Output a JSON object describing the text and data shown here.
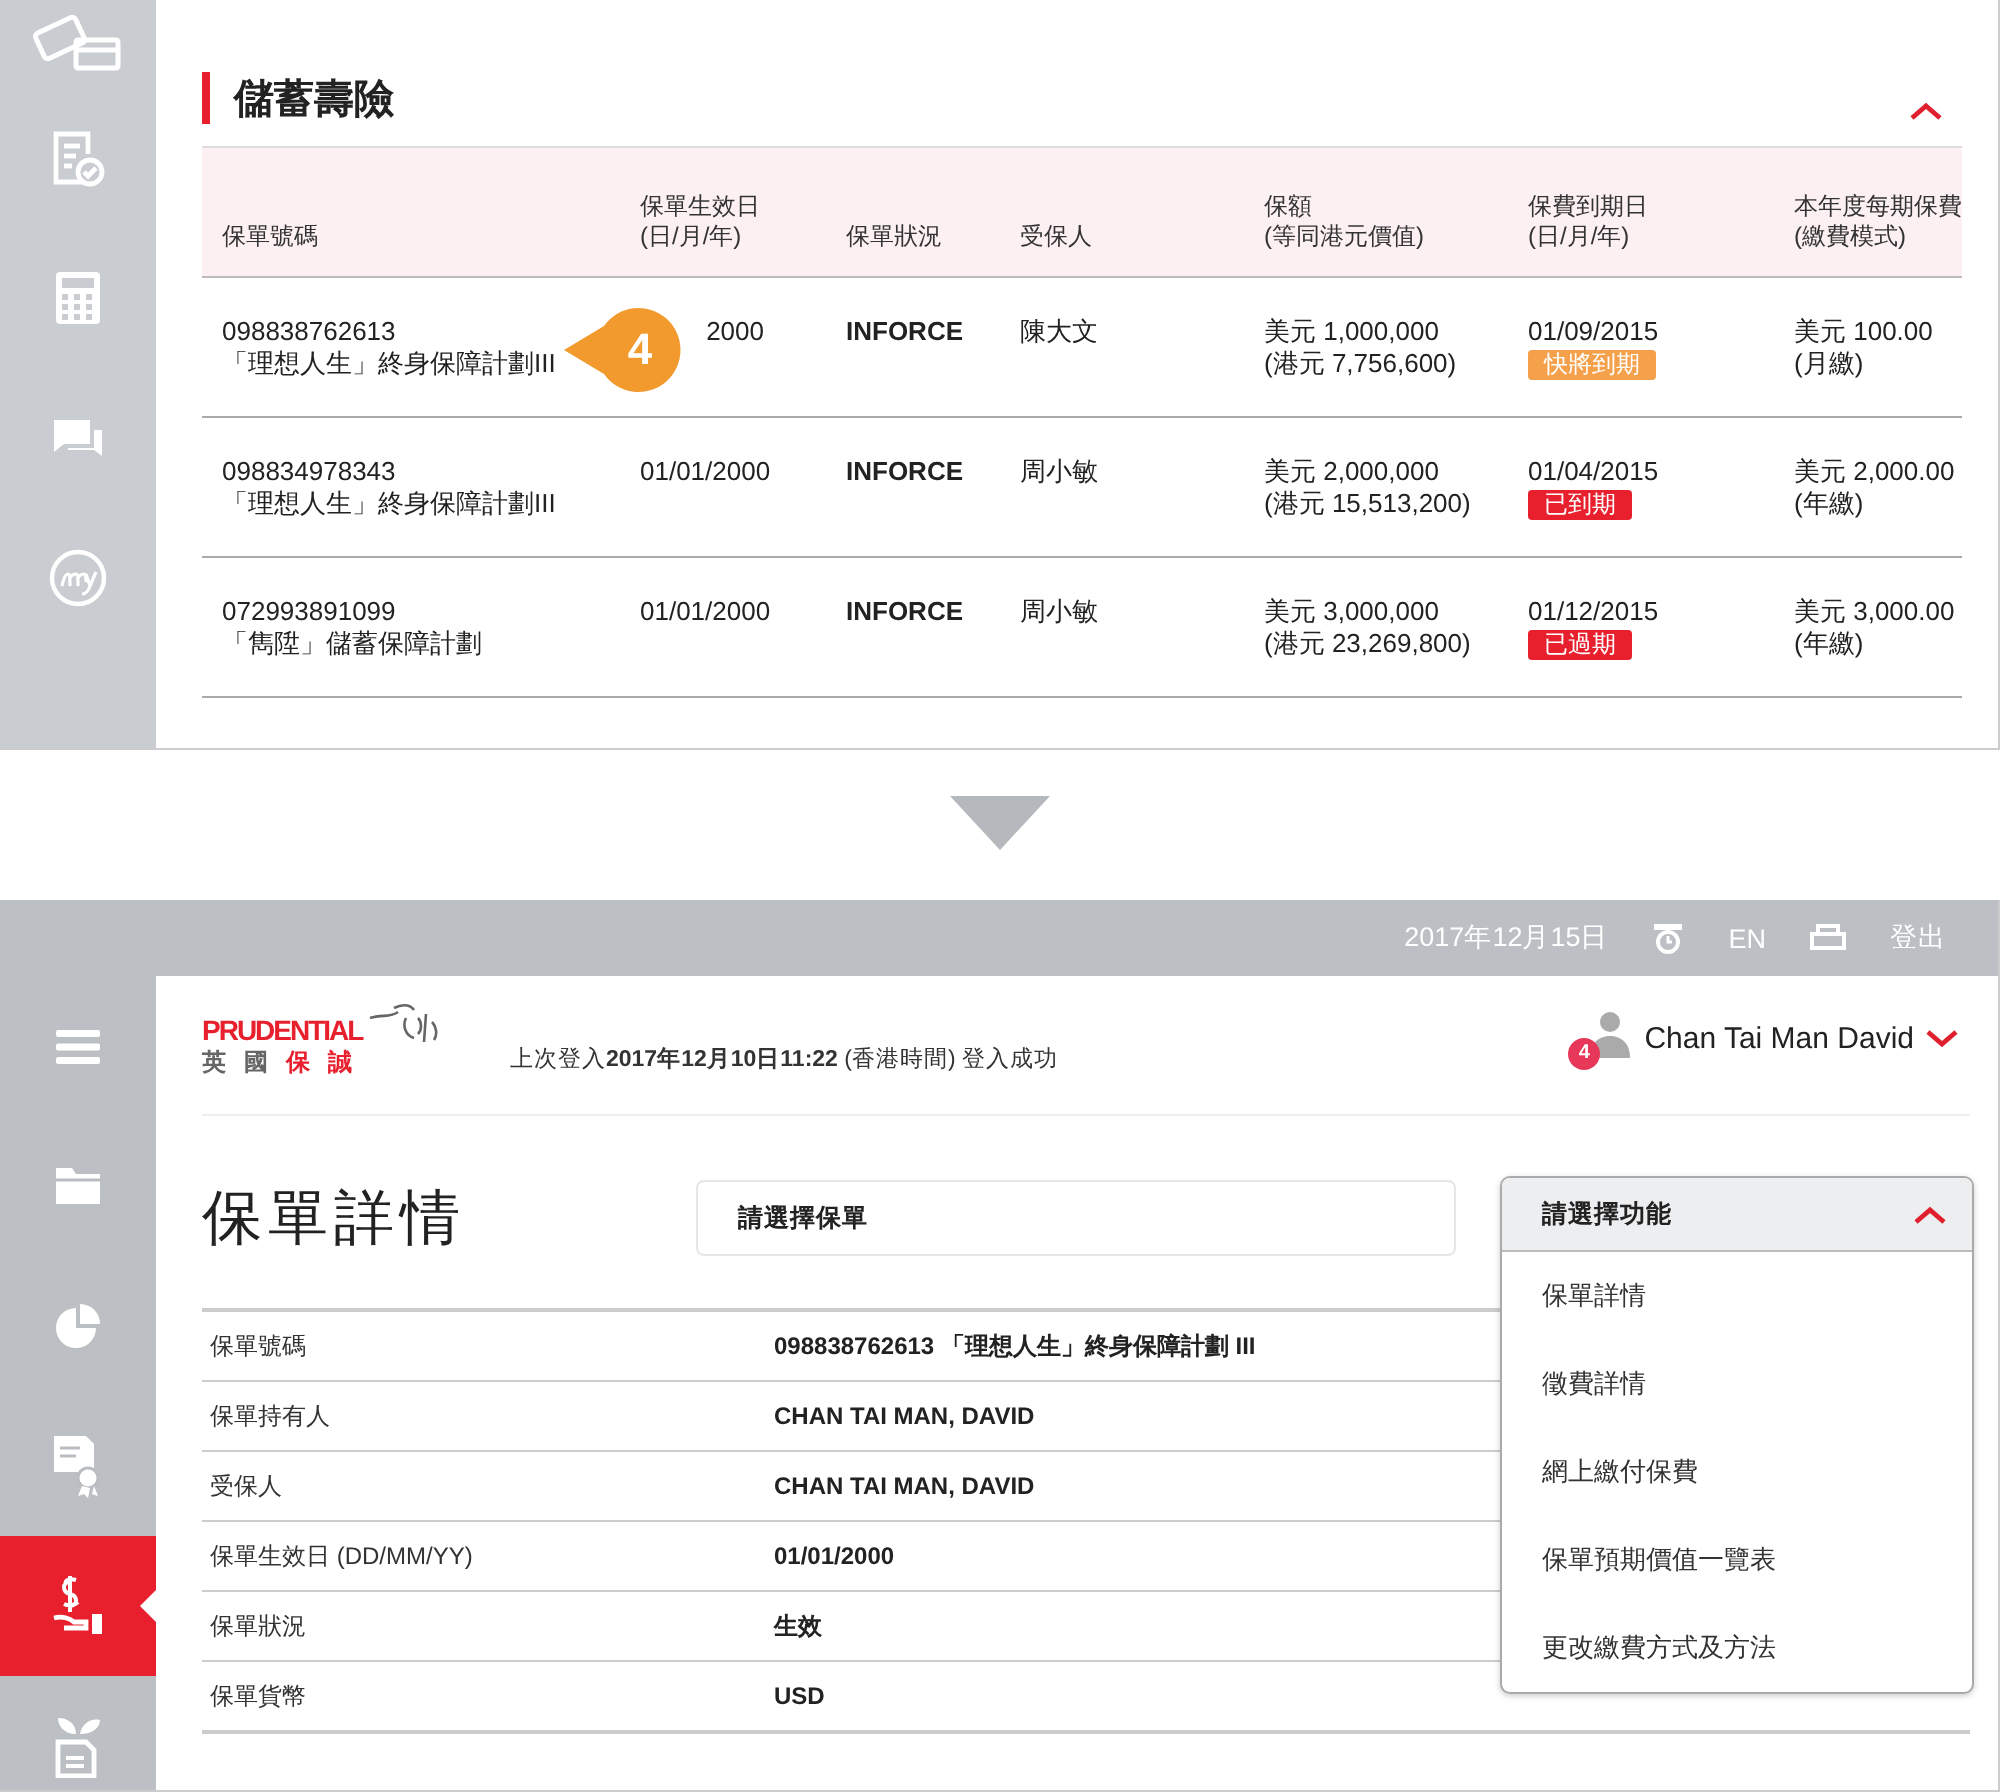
{
  "top_panel": {
    "section": {
      "title": "儲蓄壽險",
      "expanded": true
    },
    "columns": [
      "保單號碼",
      "保單生效日\n(日/月/年)",
      "保單狀況",
      "受保人",
      "保額\n(等同港元價值)",
      "保費到期日\n(日/月/年)",
      "本年度每期保費\n(繳費模式)"
    ],
    "rows": [
      {
        "policy_number": "098838762613",
        "plan": "「理想人生」終身保障計劃III",
        "effective_date": "2000",
        "status": "INFORCE",
        "insured": "陳大文",
        "sum_insured": "美元 1,000,000",
        "sum_insured_hkd": "(港元 7,756,600)",
        "due_date": "01/09/2015",
        "due_badge": {
          "text": "快將到期",
          "color": "#f5a04a"
        },
        "premium": "美元 100.00",
        "payment_mode": "(月繳)"
      },
      {
        "policy_number": "098834978343",
        "plan": "「理想人生」終身保障計劃III",
        "effective_date": "01/01/2000",
        "status": "INFORCE",
        "insured": "周小敏",
        "sum_insured": "美元 2,000,000",
        "sum_insured_hkd": "(港元 15,513,200)",
        "due_date": "01/04/2015",
        "due_badge": {
          "text": "已到期",
          "color": "#e8202e"
        },
        "premium": "美元 2,000.00",
        "payment_mode": "(年繳)"
      },
      {
        "policy_number": "072993891099",
        "plan": "「雋陞」儲蓄保障計劃",
        "effective_date": "01/01/2000",
        "status": "INFORCE",
        "insured": "周小敏",
        "sum_insured": "美元 3,000,000",
        "sum_insured_hkd": "(港元 23,269,800)",
        "due_date": "01/12/2015",
        "due_badge": {
          "text": "已過期",
          "color": "#e8202e"
        },
        "premium": "美元 3,000.00",
        "payment_mode": "(年繳)"
      }
    ],
    "callout": {
      "text": "4"
    }
  },
  "bottom_panel": {
    "top_bar": {
      "date": "2017年12月15日",
      "language": "EN",
      "logout": "登出"
    },
    "sidebar": {
      "items": [
        {
          "selected": false
        },
        {
          "selected": false
        },
        {
          "selected": false
        },
        {
          "selected": false
        },
        {
          "selected": true
        },
        {
          "selected": false
        }
      ]
    },
    "header": {
      "logo": {
        "brand": "PRUDENTIAL",
        "name_cn_1": "英國",
        "name_cn_2": "保誠"
      },
      "last_login": "上次登入**2017年12月10日11:22** (香港時間) 登入成功",
      "user": {
        "name": "Chan Tai Man David",
        "notification_count": "4"
      }
    },
    "page_title": "保單詳情",
    "policy_select": {
      "placeholder": "請選擇保單"
    },
    "function_menu": {
      "label": "請選擇功能",
      "expanded": true,
      "items": [
        "保單詳情",
        "徵費詳情",
        "網上繳付保費",
        "保單預期價值一覽表",
        "更改繳費方式及方法"
      ]
    },
    "details": [
      {
        "label": "保單號碼",
        "value": "098838762613 「理想人生」終身保障計劃 III"
      },
      {
        "label": "保單持有人",
        "value": "CHAN TAI MAN, DAVID"
      },
      {
        "label": "受保人",
        "value": "CHAN TAI MAN, DAVID"
      },
      {
        "label": "保單生效日 (DD/MM/YY)",
        "value": "01/01/2000"
      },
      {
        "label": "保單狀況",
        "value": "生效"
      },
      {
        "label": "保單貨幣",
        "value": "USD"
      }
    ]
  }
}
